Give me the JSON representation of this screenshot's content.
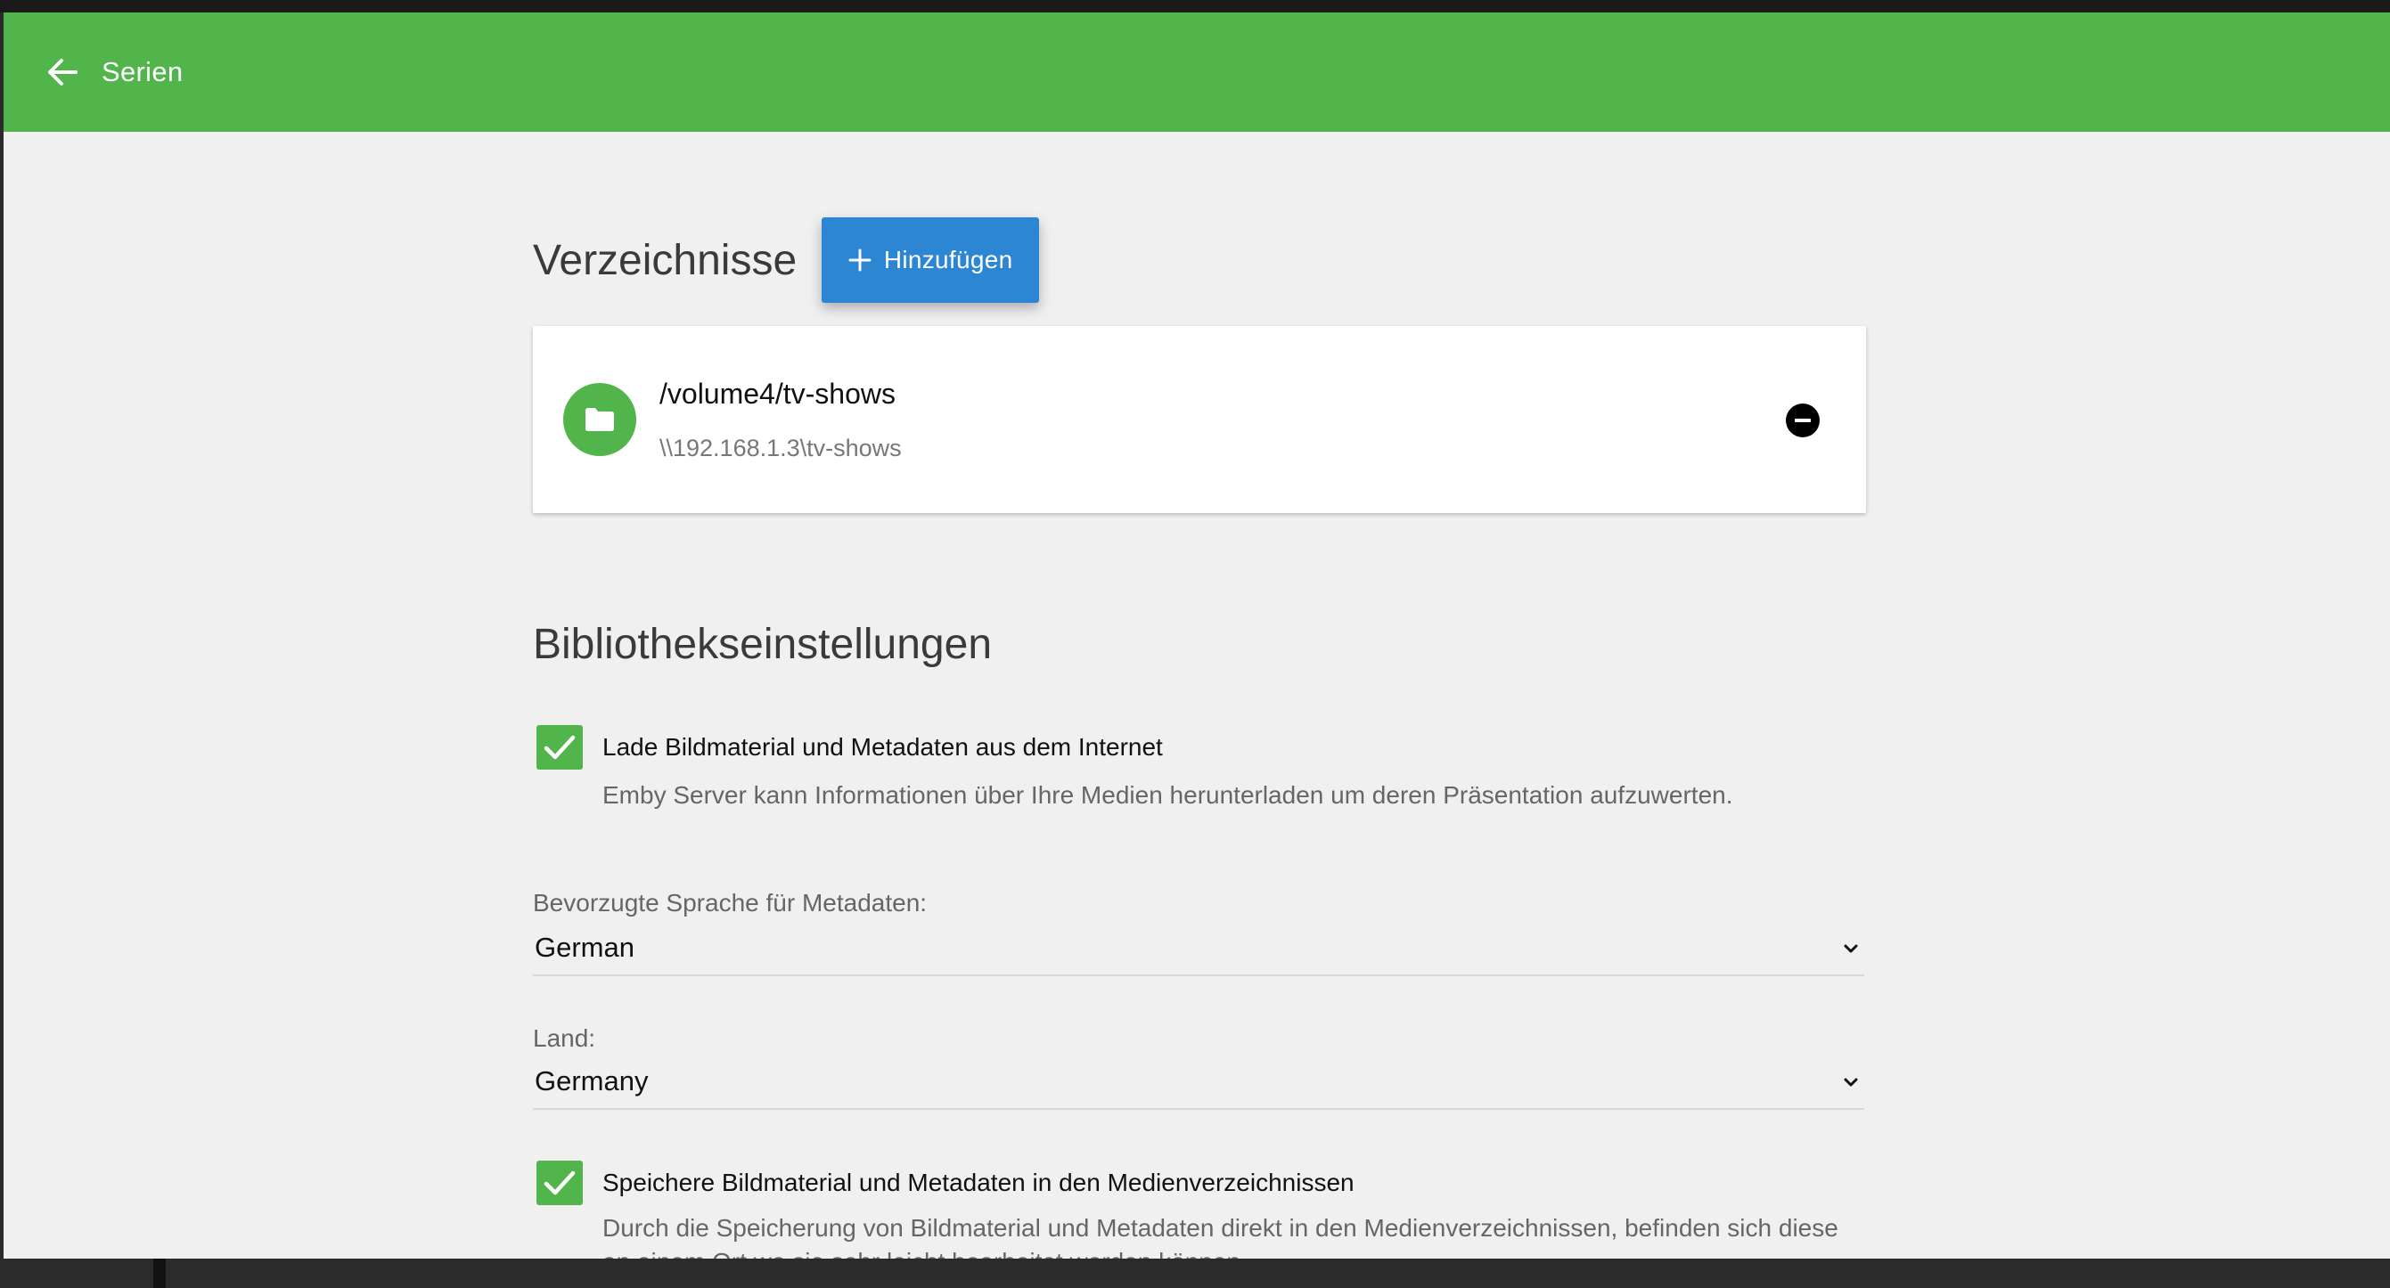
{
  "appbar": {
    "title": "Serien",
    "back_icon": "arrow-left-icon",
    "background": "#52b54b"
  },
  "folders": {
    "title": "Verzeichnisse",
    "add_label": "Hinzufügen",
    "add_icon": "plus-icon",
    "add_color": "#2d86d4",
    "items": [
      {
        "path": "/volume4/tv-shows",
        "share": "\\\\192.168.1.3\\tv-shows",
        "icon": "folder-icon",
        "remove_icon": "remove-circle-icon"
      }
    ]
  },
  "library_settings": {
    "title": "Bibliothekseinstellungen",
    "download_metadata": {
      "checked": true,
      "label": "Lade Bildmaterial und Metadaten aus dem Internet",
      "description": "Emby Server kann Informationen über Ihre Medien herunterladen um deren Präsentation aufzuwerten."
    },
    "metadata_language": {
      "label": "Bevorzugte Sprache für Metadaten:",
      "value": "German"
    },
    "country": {
      "label": "Land:",
      "value": "Germany"
    },
    "save_local": {
      "checked": true,
      "label": "Speichere Bildmaterial und Metadaten in den Medienverzeichnissen",
      "description": "Durch die Speicherung von Bildmaterial und Metadaten direkt in den Medienverzeichnissen, befinden sich diese an einem Ort wo sie sehr leicht bearbeitet werden können."
    }
  },
  "colors": {
    "accent": "#52b54b",
    "button": "#2d86d4",
    "background": "#f0f0f0"
  }
}
